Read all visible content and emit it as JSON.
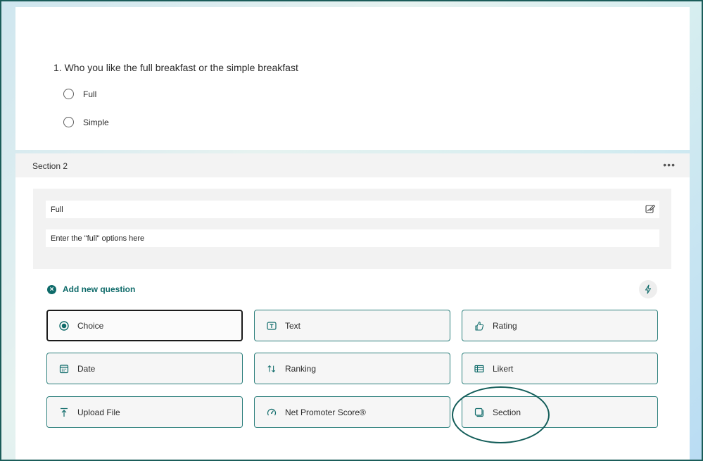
{
  "question": {
    "title": "1. Who you like the full breakfast or the simple breakfast",
    "options": [
      "Full",
      "Simple"
    ]
  },
  "section": {
    "title": "Section 2",
    "more_icon": "ellipsis-icon",
    "title_field_value": "Full",
    "description_field_value": "Enter the \"full\" options here"
  },
  "add_question": {
    "label": "Add new question",
    "types": [
      {
        "label": "Choice",
        "icon": "radio-selected-icon"
      },
      {
        "label": "Text",
        "icon": "text-box-icon"
      },
      {
        "label": "Rating",
        "icon": "thumbs-up-icon"
      },
      {
        "label": "Date",
        "icon": "calendar-icon"
      },
      {
        "label": "Ranking",
        "icon": "sort-arrows-icon"
      },
      {
        "label": "Likert",
        "icon": "table-icon"
      },
      {
        "label": "Upload File",
        "icon": "upload-icon"
      },
      {
        "label": "Net Promoter Score®",
        "icon": "gauge-icon"
      },
      {
        "label": "Section",
        "icon": "section-icon"
      }
    ]
  },
  "colors": {
    "accent": "#0f6b6a",
    "border_teal": "#2c7f7c",
    "annotation": "#125c58"
  }
}
